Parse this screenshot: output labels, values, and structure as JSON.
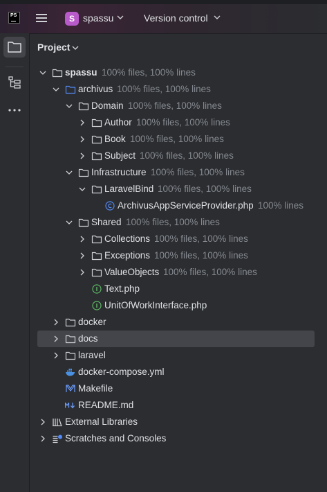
{
  "titlebar": {
    "logo_text": "PS",
    "project_initial": "S",
    "project_name": "spassu",
    "vcs_label": "Version control",
    "project_color": "#b85ac9"
  },
  "leftbar": {
    "icons": [
      "folder-icon",
      "structure-icon",
      "more-icon"
    ]
  },
  "panel": {
    "title": "Project"
  },
  "tree": [
    {
      "label": "spassu",
      "coverage": "100% files, 100% lines",
      "type": "folder",
      "expanded": true,
      "depth": 0,
      "bold": true
    },
    {
      "label": "archivus",
      "coverage": "100% files, 100% lines",
      "type": "folder-module",
      "expanded": true,
      "depth": 1
    },
    {
      "label": "Domain",
      "coverage": "100% files, 100% lines",
      "type": "folder",
      "expanded": true,
      "depth": 2
    },
    {
      "label": "Author",
      "coverage": "100% files, 100% lines",
      "type": "folder",
      "expanded": false,
      "depth": 3
    },
    {
      "label": "Book",
      "coverage": "100% files, 100% lines",
      "type": "folder",
      "expanded": false,
      "depth": 3
    },
    {
      "label": "Subject",
      "coverage": "100% files, 100% lines",
      "type": "folder",
      "expanded": false,
      "depth": 3
    },
    {
      "label": "Infrastructure",
      "coverage": "100% files, 100% lines",
      "type": "folder",
      "expanded": true,
      "depth": 2
    },
    {
      "label": "LaravelBind",
      "coverage": "100% files, 100% lines",
      "type": "folder",
      "expanded": true,
      "depth": 3
    },
    {
      "label": "ArchivusAppServiceProvider.php",
      "coverage": "100% lines",
      "type": "php-class",
      "depth": 4
    },
    {
      "label": "Shared",
      "coverage": "100% files, 100% lines",
      "type": "folder",
      "expanded": true,
      "depth": 2
    },
    {
      "label": "Collections",
      "coverage": "100% files, 100% lines",
      "type": "folder",
      "expanded": false,
      "depth": 3
    },
    {
      "label": "Exceptions",
      "coverage": "100% files, 100% lines",
      "type": "folder",
      "expanded": false,
      "depth": 3
    },
    {
      "label": "ValueObjects",
      "coverage": "100% files, 100% lines",
      "type": "folder",
      "expanded": false,
      "depth": 3
    },
    {
      "label": "Text.php",
      "coverage": "",
      "type": "php-interface",
      "depth": 3
    },
    {
      "label": "UnitOfWorkInterface.php",
      "coverage": "",
      "type": "php-interface",
      "depth": 3
    },
    {
      "label": "docker",
      "coverage": "",
      "type": "folder",
      "expanded": false,
      "depth": 1
    },
    {
      "label": "docs",
      "coverage": "",
      "type": "folder",
      "expanded": false,
      "depth": 1,
      "selected": true
    },
    {
      "label": "laravel",
      "coverage": "",
      "type": "folder",
      "expanded": false,
      "depth": 1
    },
    {
      "label": "docker-compose.yml",
      "coverage": "",
      "type": "docker",
      "depth": 1
    },
    {
      "label": "Makefile",
      "coverage": "",
      "type": "makefile",
      "depth": 1
    },
    {
      "label": "README.md",
      "coverage": "",
      "type": "markdown",
      "depth": 1
    },
    {
      "label": "External Libraries",
      "coverage": "",
      "type": "libraries",
      "expanded": false,
      "depth": 0
    },
    {
      "label": "Scratches and Consoles",
      "coverage": "",
      "type": "scratches",
      "expanded": false,
      "depth": 0
    }
  ],
  "colors": {
    "background": "#2b2d30",
    "selection": "#43454a",
    "text": "#dfe1e5",
    "muted": "#868a91",
    "module_folder": "#548af7",
    "php_class": "#548af7",
    "php_interface": "#5fb865",
    "docker": "#4a90e2"
  }
}
